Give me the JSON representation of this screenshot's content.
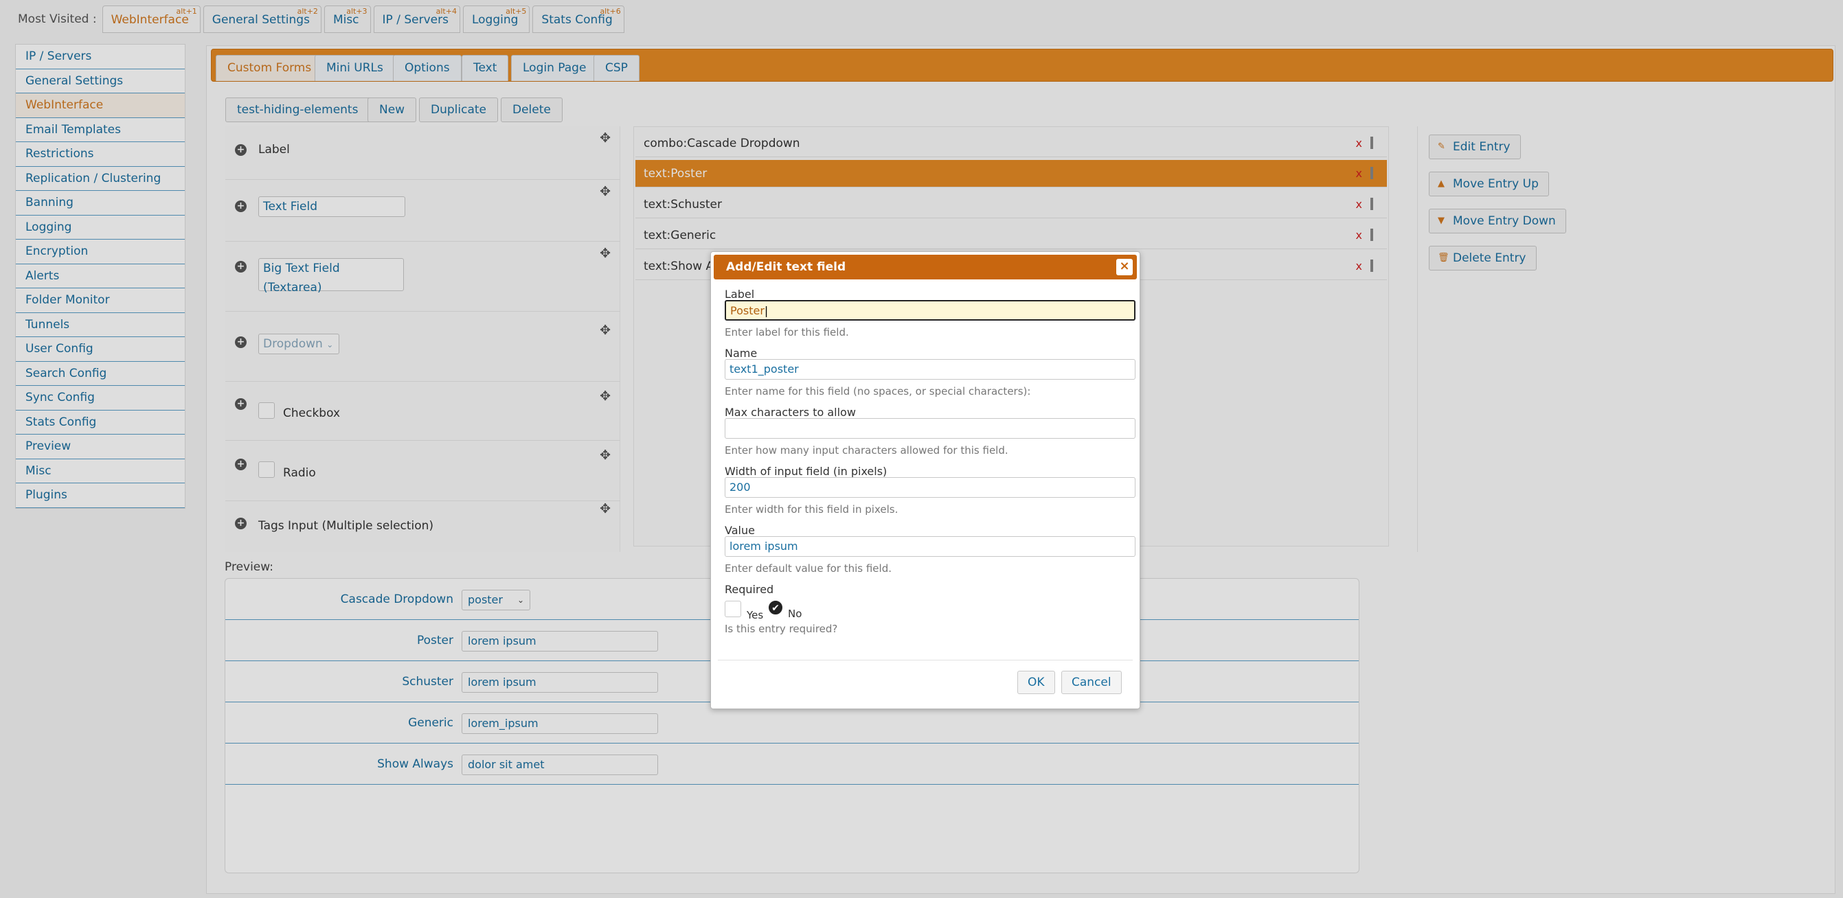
{
  "topbar": {
    "label": "Most Visited :",
    "items": [
      {
        "label": "WebInterface",
        "shortcut": "alt+1"
      },
      {
        "label": "General Settings",
        "shortcut": "alt+2"
      },
      {
        "label": "Misc",
        "shortcut": "alt+3"
      },
      {
        "label": "IP / Servers",
        "shortcut": "alt+4"
      },
      {
        "label": "Logging",
        "shortcut": "alt+5"
      },
      {
        "label": "Stats Config",
        "shortcut": "alt+6"
      }
    ]
  },
  "sidebar": {
    "active": "WebInterface",
    "items": [
      "IP / Servers",
      "General Settings",
      "WebInterface",
      "Email Templates",
      "Restrictions",
      "Replication / Clustering",
      "Banning",
      "Logging",
      "Encryption",
      "Alerts",
      "Folder Monitor",
      "Tunnels",
      "User Config",
      "Search Config",
      "Sync Config",
      "Stats Config",
      "Preview",
      "Misc",
      "Plugins"
    ]
  },
  "tabs": [
    "Custom Forms",
    "Mini URLs",
    "Options",
    "Text",
    "Login Page",
    "CSP"
  ],
  "toolbar": {
    "form_select": "test-hiding-elements",
    "new": "New",
    "duplicate": "Duplicate",
    "delete": "Delete"
  },
  "palette": {
    "label": "Label",
    "text_field": "Text Field",
    "textarea": "Big Text Field (Textarea)",
    "dropdown": "Dropdown",
    "checkbox": "Checkbox",
    "radio": "Radio",
    "tags": "Tags Input (Multiple selection)"
  },
  "entries": [
    "combo:Cascade Dropdown",
    "text:Poster",
    "text:Schuster",
    "text:Generic",
    "text:Show Al"
  ],
  "entry_remove": "x",
  "actions": {
    "edit": "Edit Entry",
    "up": "Move Entry Up",
    "down": "Move Entry Down",
    "delete": "Delete Entry"
  },
  "preview": {
    "title": "Preview:",
    "rows": [
      {
        "label": "Cascade Dropdown",
        "value": "poster"
      },
      {
        "label": "Poster",
        "value": "lorem ipsum"
      },
      {
        "label": "Schuster",
        "value": "lorem ipsum"
      },
      {
        "label": "Generic",
        "value": "lorem_ipsum"
      },
      {
        "label": "Show Always",
        "value": "dolor sit amet"
      }
    ]
  },
  "dialog": {
    "title": "Add/Edit text field",
    "close": "×",
    "label_label": "Label",
    "label_value": "Poster",
    "label_hint": "Enter label for this field.",
    "name_label": "Name",
    "name_value": "text1_poster",
    "name_hint": "Enter name for this field (no spaces, or special characters):",
    "max_label": "Max characters to allow",
    "max_value": "",
    "max_hint": "Enter how many input characters allowed for this field.",
    "width_label": "Width of input field (in pixels)",
    "width_value": "200",
    "width_hint": "Enter width for this field in pixels.",
    "value_label": "Value",
    "value_value": "lorem ipsum",
    "value_hint": "Enter default value for this field.",
    "required_label": "Required",
    "yes": "Yes",
    "no": "No",
    "required_hint": "Is this entry required?",
    "ok": "OK",
    "cancel": "Cancel"
  }
}
